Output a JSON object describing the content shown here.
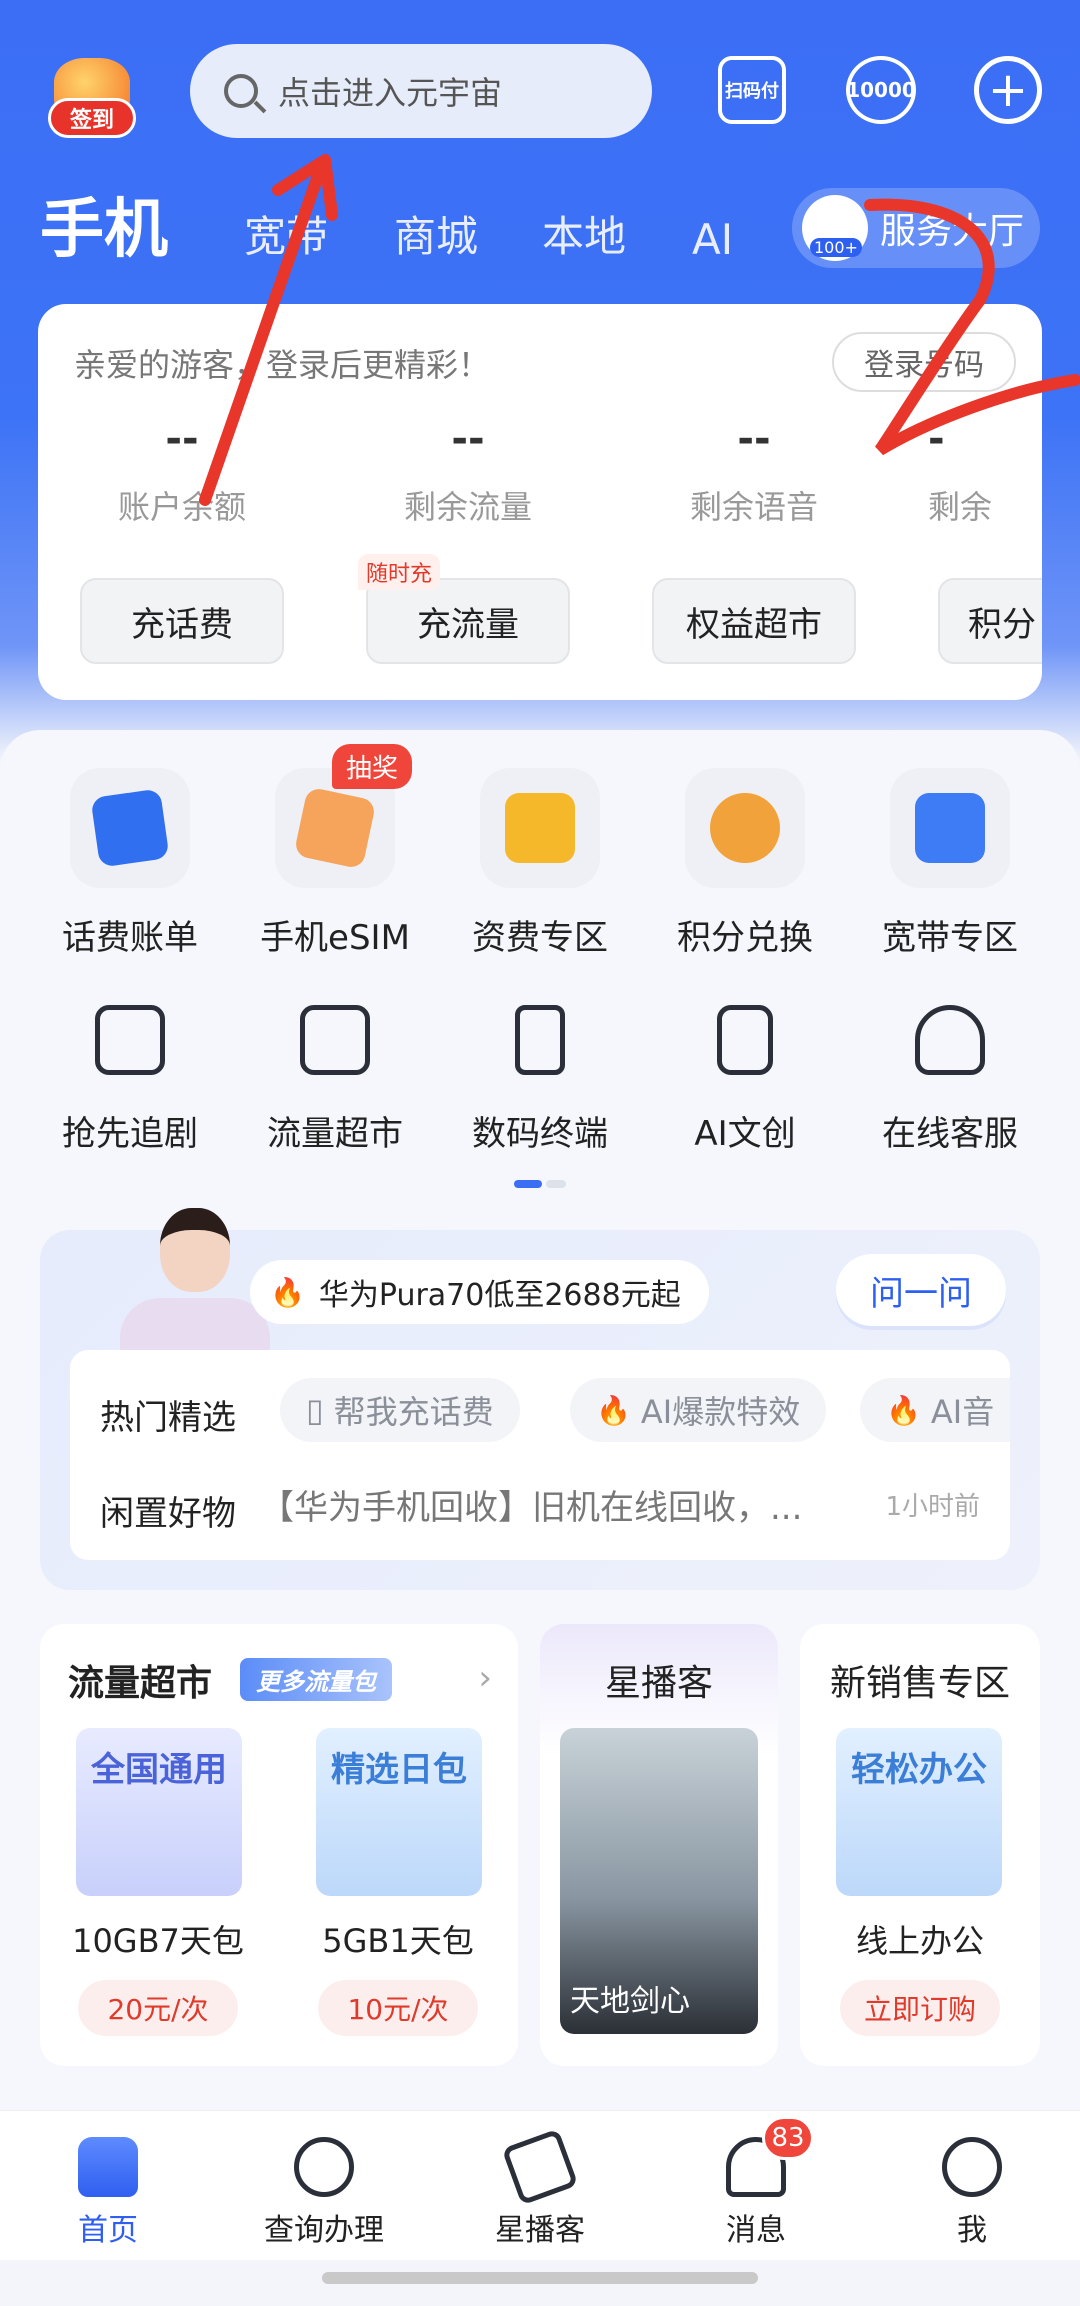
{
  "header": {
    "signin_label": "签到",
    "search_placeholder": "点击进入元宇宙",
    "scan_label": "扫码付",
    "hotline_label": "10000"
  },
  "tabs": [
    {
      "label": "手机",
      "active": true
    },
    {
      "label": "宽带"
    },
    {
      "label": "商城"
    },
    {
      "label": "本地"
    },
    {
      "label": "AI"
    }
  ],
  "service_hall": {
    "label": "服务大厅",
    "badge": "100+"
  },
  "account": {
    "greeting": "亲爱的游客，登录后更精彩！",
    "login_button": "登录号码",
    "stats": [
      {
        "value": "--",
        "label": "账户余额"
      },
      {
        "value": "--",
        "label": "剩余流量"
      },
      {
        "value": "--",
        "label": "剩余语音"
      },
      {
        "value": "-",
        "label": "剩余"
      }
    ],
    "actions": [
      "充话费",
      "充流量",
      "权益超市",
      "积分"
    ],
    "tag_recharge": "随时充"
  },
  "grid_row1": [
    {
      "label": "话费账单",
      "color": "#2f6ff0"
    },
    {
      "label": "手机eSIM",
      "color": "#f6a45c"
    },
    {
      "label": "资费专区",
      "color": "#f5b82a"
    },
    {
      "label": "积分兑换",
      "color": "#f2a23a"
    },
    {
      "label": "宽带专区",
      "color": "#3d7cf5"
    }
  ],
  "lottery_tag": "抽奖",
  "grid_row2": [
    {
      "label": "抢先追剧",
      "icon": "tv-icon"
    },
    {
      "label": "流量超市",
      "icon": "store-icon"
    },
    {
      "label": "数码终端",
      "icon": "phone-check-icon"
    },
    {
      "label": "AI文创",
      "icon": "ai-doc-icon"
    },
    {
      "label": "在线客服",
      "icon": "headset-icon"
    }
  ],
  "ai_card": {
    "promo": "华为Pura70低至2688元起",
    "ask_button": "问一问",
    "hot_title": "热门精选",
    "chips": [
      "帮我充话费",
      "AI爆款特效",
      "AI音"
    ],
    "idle_title": "闲置好物",
    "idle_text": "【华为手机回收】旧机在线回收，...",
    "idle_time": "1小时前"
  },
  "traffic_market": {
    "title": "流量超市",
    "tag": "更多流量包",
    "items": [
      {
        "image_text": "全国通用",
        "name": "10GB7天包",
        "price": "20元/次"
      },
      {
        "image_text": "精选日包",
        "name": "5GB1天包",
        "price": "10元/次"
      }
    ]
  },
  "star_broadcast": {
    "title": "星播客",
    "poster_title": "天地剑心"
  },
  "new_sales": {
    "title": "新销售专区",
    "image_text": "轻松办公",
    "name": "线上办公",
    "button": "立即订购"
  },
  "bottom_nav": [
    {
      "label": "首页",
      "active": true
    },
    {
      "label": "查询办理"
    },
    {
      "label": "星播客"
    },
    {
      "label": "消息"
    },
    {
      "label": "我"
    }
  ],
  "message_badge": "83"
}
